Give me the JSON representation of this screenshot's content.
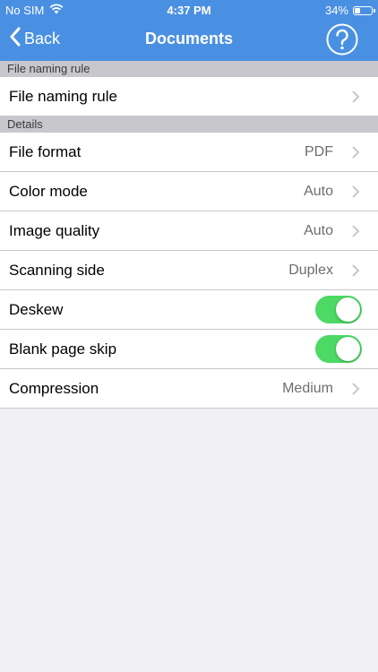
{
  "status_bar": {
    "carrier": "No SIM",
    "time": "4:37 PM",
    "battery_percent": "34%",
    "battery_level": 0.34
  },
  "nav": {
    "back_label": "Back",
    "title": "Documents"
  },
  "sections": [
    {
      "header": "File naming rule",
      "rows": [
        {
          "label": "File naming rule",
          "value": ""
        }
      ]
    },
    {
      "header": "Details",
      "rows": [
        {
          "label": "File format",
          "value": "PDF"
        },
        {
          "label": "Color mode",
          "value": "Auto"
        },
        {
          "label": "Image quality",
          "value": "Auto"
        },
        {
          "label": "Scanning side",
          "value": "Duplex"
        },
        {
          "label": "Deskew",
          "toggle": true
        },
        {
          "label": "Blank page skip",
          "toggle": true
        },
        {
          "label": "Compression",
          "value": "Medium"
        }
      ]
    }
  ],
  "colors": {
    "nav_blue": "#4a90e2",
    "toggle_on": "#4cd964",
    "section_header": "#c8c8cc",
    "background": "#efeff4"
  },
  "icons": {
    "back": "chevron-left-icon",
    "help": "question-circle-icon",
    "wifi": "wifi-icon",
    "battery": "battery-icon",
    "row_disclosure": "chevron-right-icon"
  }
}
